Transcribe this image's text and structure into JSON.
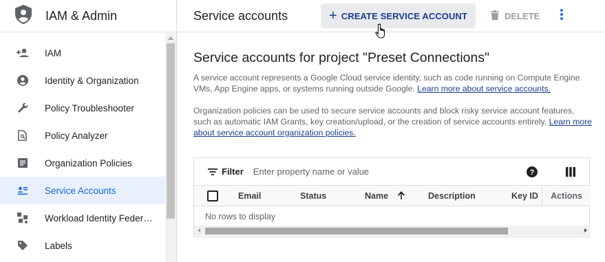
{
  "app": {
    "title": "IAM & Admin"
  },
  "sidebar": {
    "items": [
      {
        "label": "IAM",
        "icon": "person-add-icon"
      },
      {
        "label": "Identity & Organization",
        "icon": "account-circle-icon"
      },
      {
        "label": "Policy Troubleshooter",
        "icon": "wrench-icon"
      },
      {
        "label": "Policy Analyzer",
        "icon": "document-search-icon"
      },
      {
        "label": "Organization Policies",
        "icon": "list-document-icon"
      },
      {
        "label": "Service Accounts",
        "icon": "service-account-icon",
        "active": true
      },
      {
        "label": "Workload Identity Federat…",
        "icon": "federation-icon"
      },
      {
        "label": "Labels",
        "icon": "label-icon"
      }
    ]
  },
  "toolbar": {
    "page_title": "Service accounts",
    "create_label": "CREATE SERVICE ACCOUNT",
    "delete_label": "DELETE"
  },
  "main": {
    "heading": "Service accounts for project \"Preset Connections\"",
    "para1_text": "A service account represents a Google Cloud service identity, such as code running on Compute Engine VMs, App Engine apps, or systems running outside Google. ",
    "para1_link": "Learn more about service accounts.",
    "para2_text": "Organization policies can be used to secure service accounts and block risky service account features, such as automatic IAM Grants, key creation/upload, or the creation of service accounts entirely. ",
    "para2_link": "Learn more about service account organization policies."
  },
  "table": {
    "filter_label": "Filter",
    "filter_placeholder": "Enter property name or value",
    "columns": [
      "Email",
      "Status",
      "Name",
      "Description",
      "Key ID",
      "Actions"
    ],
    "empty_text": "No rows to display"
  },
  "colors": {
    "accent": "#1a3d8f",
    "active_bg": "#e8f0fe",
    "active_text": "#1967d2"
  }
}
